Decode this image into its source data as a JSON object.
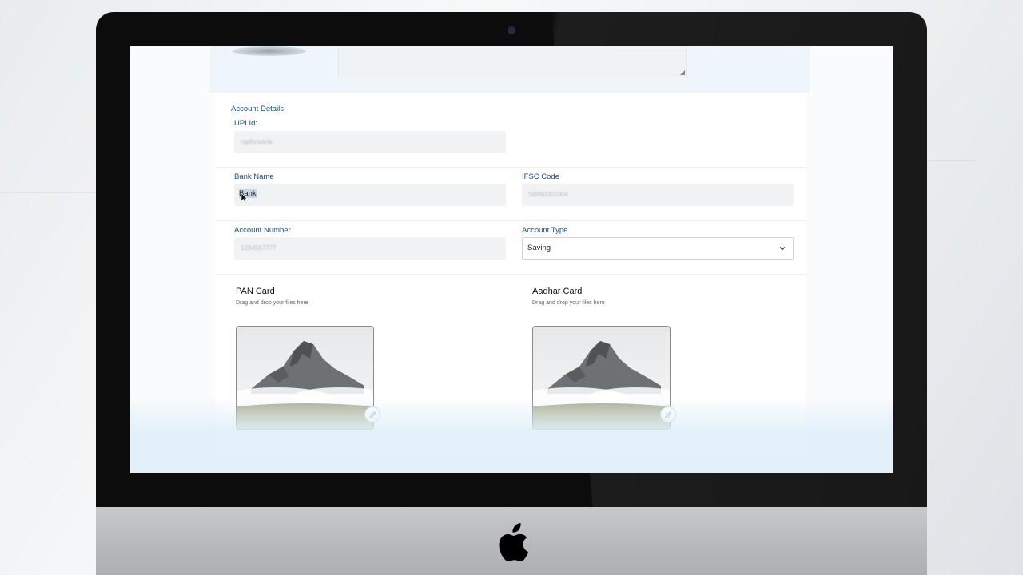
{
  "form": {
    "section_title": "Account Details",
    "upi": {
      "label": "UPI Id:",
      "value": "rajdhrisarla"
    },
    "bank_name": {
      "label": "Bank Name",
      "value": "Bank"
    },
    "ifsc": {
      "label": "IFSC Code",
      "value": "SBIN0001004"
    },
    "account_number": {
      "label": "Account Number",
      "value": "1234567777"
    },
    "account_type": {
      "label": "Account Type",
      "selected": "Saving"
    }
  },
  "uploads": [
    {
      "title": "PAN Card",
      "hint": "Drag and drop your files here"
    },
    {
      "title": "Aadhar Card",
      "hint": "Drag and drop your files here"
    }
  ],
  "icons": {
    "camera": "camera-dot",
    "chevron": "chevron-down-icon",
    "edit": "pencil-icon",
    "logo": "apple-logo"
  },
  "colors": {
    "label_blue": "#1e4c80",
    "bezel": "#0c0c0c",
    "selection": "#c7d7ea"
  }
}
